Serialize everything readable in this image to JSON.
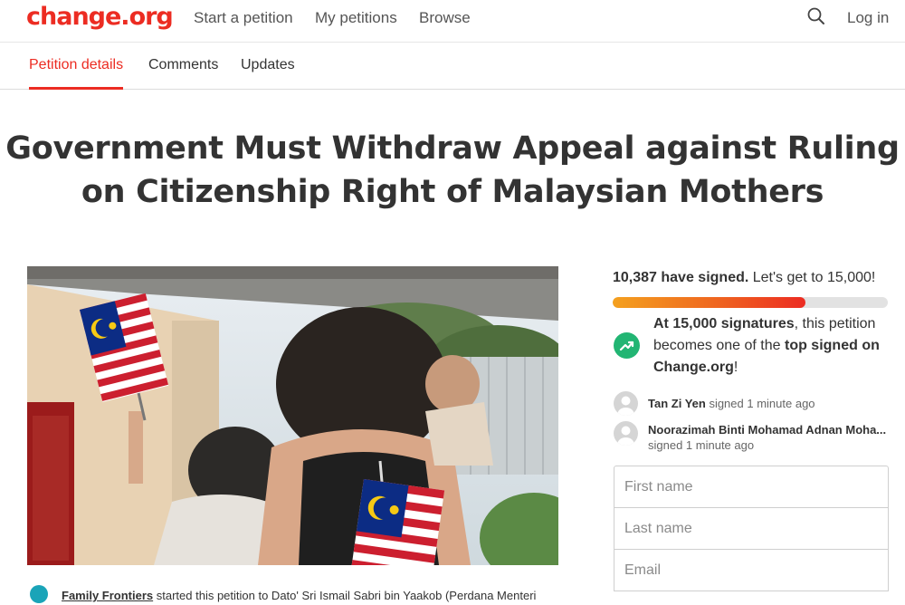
{
  "brand": {
    "logo_text": "change.org",
    "color": "#ec2c22"
  },
  "nav": {
    "start": "Start a petition",
    "mine": "My petitions",
    "browse": "Browse",
    "search_icon": "search-icon",
    "login": "Log in"
  },
  "tabs": {
    "details": "Petition details",
    "comments": "Comments",
    "updates": "Updates",
    "active": "Petition details"
  },
  "petition": {
    "title_line1": "Government Must Withdraw Appeal against Ruling",
    "title_line2": "on Citizenship Right of Malaysian Mothers",
    "starter_name": "Family Frontiers",
    "starter_text": " started this petition to Dato' Sri Ismail Sabri bin Yaakob (Perdana Menteri"
  },
  "signatures": {
    "count_text": "10,387 have signed.",
    "goal_text": " Let's get to 15,000!",
    "progress_fraction": 0.7,
    "milestone_bold": "At 15,000 signatures",
    "milestone_mid": ", this petition becomes one of the ",
    "milestone_bold2": "top signed on Change.org",
    "milestone_end": "!"
  },
  "recent_signers": [
    {
      "name": "Tan Zi Yen",
      "time": " signed 1 minute ago"
    },
    {
      "name": "Noorazimah Binti Mohamad Adnan Moha...",
      "time": "signed 1 minute ago"
    }
  ],
  "form": {
    "first_name_placeholder": "First name",
    "last_name_placeholder": "Last name",
    "email_placeholder": "Email"
  },
  "colors": {
    "accent": "#ec2c22",
    "milestone": "#22b573"
  }
}
